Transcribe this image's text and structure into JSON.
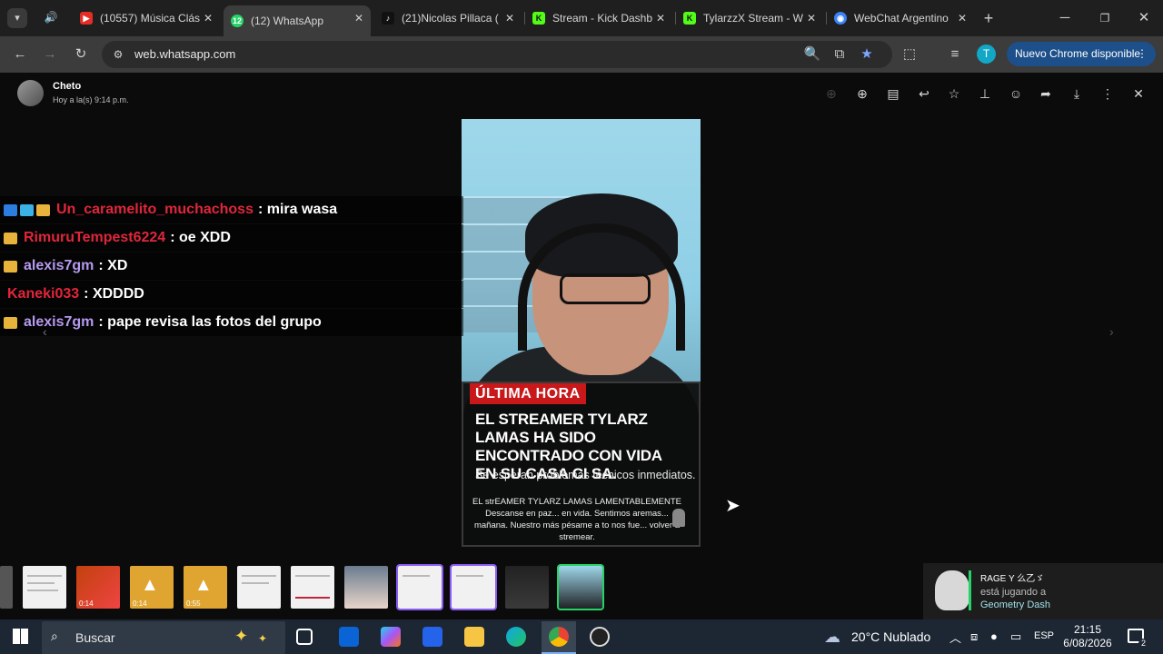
{
  "browser": {
    "tabs": [
      {
        "title": "(10557) Música Clás",
        "favicon": "youtube",
        "color": "#e52d27"
      },
      {
        "title": "(12) WhatsApp",
        "favicon": "whatsapp",
        "color": "#25d366",
        "active": true
      },
      {
        "title": "(21)Nicolas Pillaca (",
        "favicon": "tiktok",
        "color": "#111111"
      },
      {
        "title": "Stream - Kick Dashb",
        "favicon": "kick",
        "color": "#53fc18"
      },
      {
        "title": "TylarzzX Stream - W",
        "favicon": "kick",
        "color": "#53fc18"
      },
      {
        "title": "WebChat Argentino",
        "favicon": "webchat",
        "color": "#3b82f6"
      }
    ],
    "url": "web.whatsapp.com",
    "new_chrome": "Nuevo Chrome disponible",
    "profile_initial": "T"
  },
  "viewer": {
    "sender": "Cheto",
    "timestamp": "Hoy a la(s) 9:14 p.m."
  },
  "chat": [
    {
      "user": "Un_caramelito_muchachoss",
      "color": "#e0263b",
      "message": ": mira wasa"
    },
    {
      "user": "RimuruTempest6224",
      "color": "#e0263b",
      "message": ": oe XDD"
    },
    {
      "user": "alexis7gm",
      "color": "#b69af0",
      "message": ": XD"
    },
    {
      "user": "Kaneki033",
      "color": "#e0263b",
      "message": ": XDDDD"
    },
    {
      "user": "alexis7gm",
      "color": "#b69af0",
      "message": ": pape revisa las fotos del grupo"
    }
  ],
  "news": {
    "tag": "ÚLTIMA HORA",
    "headline": "EL STREAMER TYLARZ LAMAS HA SIDO ENCONTRADO CON VIDA EN SU CASA CI SA.",
    "subtitle": "Se esperan problemas técnicos inmediatos.",
    "fine": "EL strEAMER TYLARZ LAMAS LAMENTABLEMENTE Descanse en paz... en vida. Sentimos aremas... mañana. Nuestro más pésame a to nos fue... volver a stremear."
  },
  "thumbnails": [
    {
      "duration": "0:14"
    },
    {
      "duration": "0:14"
    },
    {
      "duration": "0:55"
    }
  ],
  "notification": {
    "title": "RAGE Y 么乙ゞ",
    "status": "está jugando a",
    "game": "Geometry Dash"
  },
  "taskbar": {
    "search": "Buscar",
    "weather": "20°C  Nublado",
    "lang": "ESP",
    "time": "21:15",
    "date": "6/08/2026",
    "notifications": "2"
  }
}
